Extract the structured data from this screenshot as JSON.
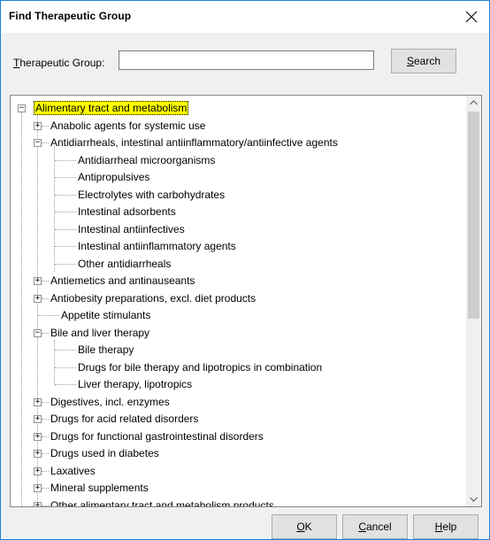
{
  "window": {
    "title": "Find Therapeutic Group"
  },
  "search": {
    "label_accel": "T",
    "label_rest": "herapeutic Group:",
    "value": "",
    "button_accel": "S",
    "button_rest": "earch"
  },
  "tree": {
    "root": "Alimentary tract and metabolism",
    "items": [
      "Anabolic agents for systemic use",
      "Antidiarrheals, intestinal antiinflammatory/antiinfective agents",
      "Antidiarrheal microorganisms",
      "Antipropulsives",
      "Electrolytes with carbohydrates",
      "Intestinal adsorbents",
      "Intestinal antiinfectives",
      "Intestinal antiinflammatory agents",
      "Other antidiarrheals",
      "Antiemetics and antinauseants",
      "Antiobesity preparations, excl. diet products",
      "Appetite stimulants",
      "Bile and liver therapy",
      "Bile therapy",
      "Drugs for bile therapy and lipotropics in combination",
      "Liver therapy, lipotropics",
      "Digestives, incl. enzymes",
      "Drugs for acid related disorders",
      "Drugs for functional gastrointestinal disorders",
      "Drugs used in diabetes",
      "Laxatives",
      "Mineral supplements",
      "Other alimentary tract and metabolism products"
    ],
    "expand_glyph": "+",
    "collapse_glyph": "−"
  },
  "buttons": {
    "ok_accel": "O",
    "ok_rest": "K",
    "cancel_accel": "C",
    "cancel_rest": "ancel",
    "help_accel": "H",
    "help_rest": "elp"
  },
  "colors": {
    "selection": "#ffff00",
    "border_accent": "#1883d7"
  }
}
